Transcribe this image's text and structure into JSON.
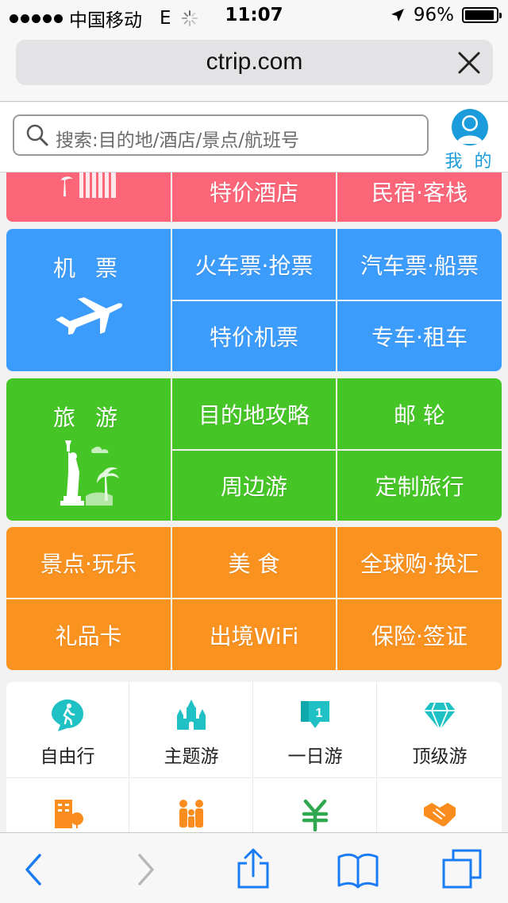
{
  "status_bar": {
    "carrier": "中国移动",
    "network": "E",
    "time": "11:07",
    "battery": "96%",
    "battery_level": 0.96
  },
  "browser": {
    "url": "ctrip.com",
    "close_icon": "close-icon"
  },
  "search": {
    "placeholder": "搜索:目的地/酒店/景点/航班号",
    "icon": "search-icon"
  },
  "account": {
    "label": "我 的",
    "icon": "user-avatar-icon"
  },
  "hotel_row": {
    "items": [
      "特价酒店",
      "民宿·客栈"
    ]
  },
  "flight_section": {
    "main_label": "机 票",
    "main_icon": "airplane-icon",
    "items": [
      "火车票·抢票",
      "汽车票·船票",
      "特价机票",
      "专车·租车"
    ]
  },
  "travel_section": {
    "main_label": "旅 游",
    "main_icon": "statue-of-liberty-icon",
    "items": [
      "目的地攻略",
      "邮 轮",
      "周边游",
      "定制旅行"
    ]
  },
  "orange_section": {
    "items": [
      "景点·玩乐",
      "美 食",
      "全球购·换汇",
      "礼品卡",
      "出境WiFi",
      "保险·签证"
    ]
  },
  "icon_grid": {
    "items": [
      {
        "label": "自由行",
        "icon": "walking-person-icon"
      },
      {
        "label": "主题游",
        "icon": "castle-icon"
      },
      {
        "label": "一日游",
        "icon": "day-tag-icon"
      },
      {
        "label": "顶级游",
        "icon": "diamond-icon"
      }
    ],
    "partial_row_icons": [
      "building-icon",
      "family-icon",
      "yuan-icon",
      "handshake-icon"
    ]
  },
  "colors": {
    "pink": "#fd6578",
    "blue": "#3c9cfc",
    "green": "#45c526",
    "orange": "#fa9220",
    "teal_icon": "#1fc1c4",
    "orange_icon": "#fb8c1e",
    "green_icon": "#2fa84f",
    "account_blue": "#1a9bdc"
  },
  "toolbar": {
    "icons": [
      "back-arrow-icon",
      "forward-arrow-icon",
      "share-icon",
      "bookmarks-icon",
      "tabs-icon"
    ]
  }
}
